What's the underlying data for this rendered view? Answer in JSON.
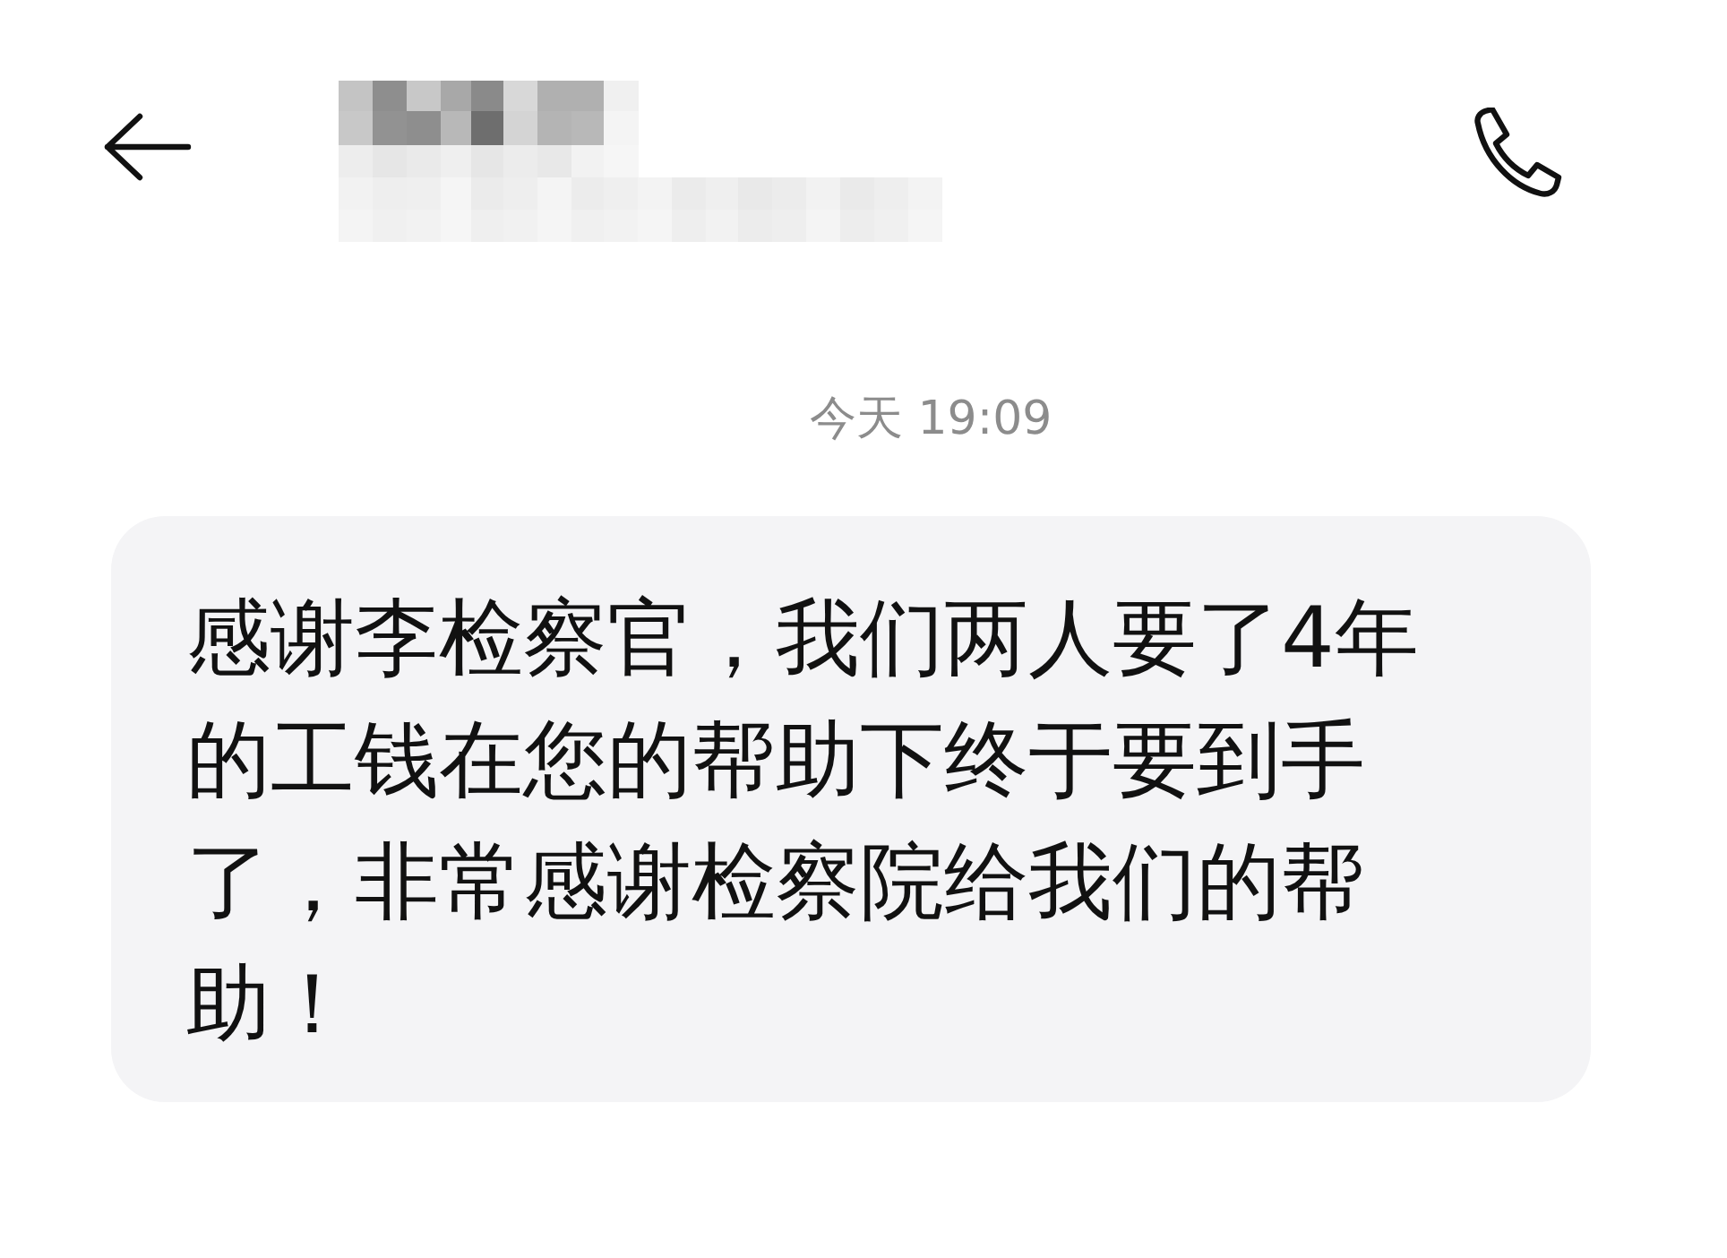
{
  "timestamp": "今天 19:09",
  "messages": [
    {
      "text": "感谢李检察官，我们两人要了4年的工钱在您的帮助下终于要到手了，非常感谢检察院给我们的帮助！"
    }
  ]
}
